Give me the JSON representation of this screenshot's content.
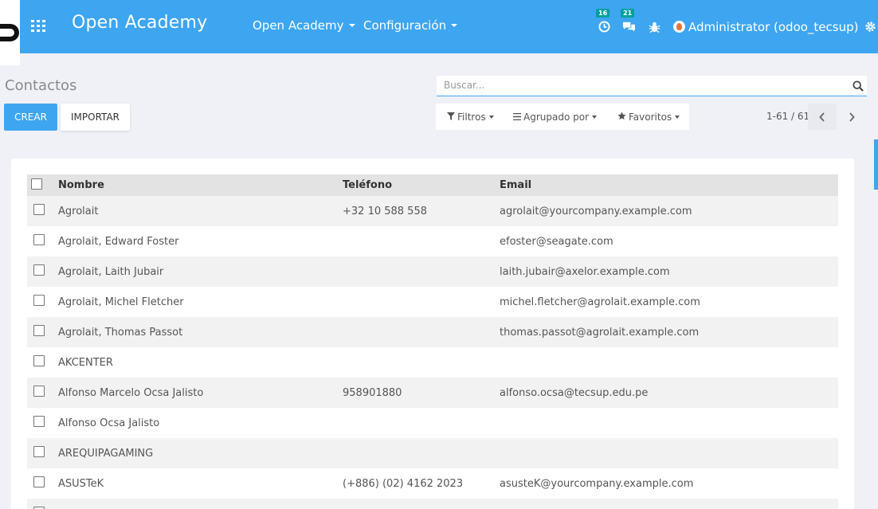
{
  "navbar": {
    "brand": "Open Academy",
    "menus": [
      {
        "label": "Open Academy"
      },
      {
        "label": "Configuración"
      }
    ],
    "activity_badge": "16",
    "messages_badge": "21",
    "user": "Administrator (odoo_tecsup)",
    "color": "#3ea5f1"
  },
  "control_panel": {
    "breadcrumb": "Contactos",
    "create_label": "CREAR",
    "import_label": "IMPORTAR",
    "search_placeholder": "Buscar...",
    "filters_label": "Filtros",
    "group_by_label": "Agrupado por",
    "favorites_label": "Favoritos",
    "pager": "1-61 / 61"
  },
  "list": {
    "columns": {
      "name": "Nombre",
      "phone": "Teléfono",
      "email": "Email"
    },
    "rows": [
      {
        "name": "Agrolait",
        "phone": "+32 10 588 558",
        "email": "agrolait@yourcompany.example.com"
      },
      {
        "name": "Agrolait, Edward Foster",
        "phone": "",
        "email": "efoster@seagate.com"
      },
      {
        "name": "Agrolait, Laith Jubair",
        "phone": "",
        "email": "laith.jubair@axelor.example.com"
      },
      {
        "name": "Agrolait, Michel Fletcher",
        "phone": "",
        "email": "michel.fletcher@agrolait.example.com"
      },
      {
        "name": "Agrolait, Thomas Passot",
        "phone": "",
        "email": "thomas.passot@agrolait.example.com"
      },
      {
        "name": "AKCENTER",
        "phone": "",
        "email": ""
      },
      {
        "name": "Alfonso Marcelo Ocsa Jalisto",
        "phone": "958901880",
        "email": "alfonso.ocsa@tecsup.edu.pe"
      },
      {
        "name": "Alfonso Ocsa Jalisto",
        "phone": "",
        "email": ""
      },
      {
        "name": "AREQUIPAGAMING",
        "phone": "",
        "email": ""
      },
      {
        "name": "ASUSTeK",
        "phone": "(+886) (02) 4162 2023",
        "email": "asusteK@yourcompany.example.com"
      },
      {
        "name": "",
        "phone": "",
        "email": ""
      }
    ]
  }
}
